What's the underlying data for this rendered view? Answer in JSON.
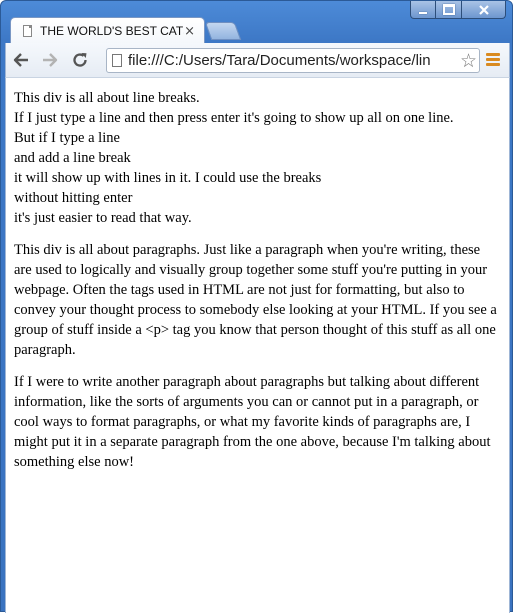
{
  "browser": {
    "tab_title": "THE WORLD'S BEST CATS",
    "tab_close": "×",
    "address": "file:///C:/Users/Tara/Documents/workspace/lin",
    "star": "☆",
    "icons": {
      "back": "back-arrow-icon",
      "forward": "forward-arrow-icon",
      "reload": "reload-icon",
      "menu": "menu-icon",
      "page": "page-icon",
      "bookmark": "star-icon"
    },
    "colors": {
      "frame": "#3d78c6",
      "menu_accent": "#d98a20"
    }
  },
  "content": {
    "linebreak_lines": [
      "This div is all about line breaks.",
      "If I just type a line and then press enter it's going to show up all on one line.",
      "But if I type a line",
      "and add a line break",
      "it will show up with lines in it. I could use the breaks",
      "without hitting enter",
      "it's just easier to read that way."
    ],
    "paragraphs": [
      "This div is all about paragraphs. Just like a paragraph when you're writing, these are used to logically and visually group together some stuff you're putting in your webpage. Often the tags used in HTML are not just for formatting, but also to convey your thought process to somebody else looking at your HTML. If you see a group of stuff inside a <p> tag you know that person thought of this stuff as all one paragraph.",
      "If I were to write another paragraph about paragraphs but talking about different information, like the sorts of arguments you can or cannot put in a paragraph, or cool ways to format paragraphs, or what my favorite kinds of paragraphs are, I might put it in a separate paragraph from the one above, because I'm talking about something else now!"
    ]
  }
}
